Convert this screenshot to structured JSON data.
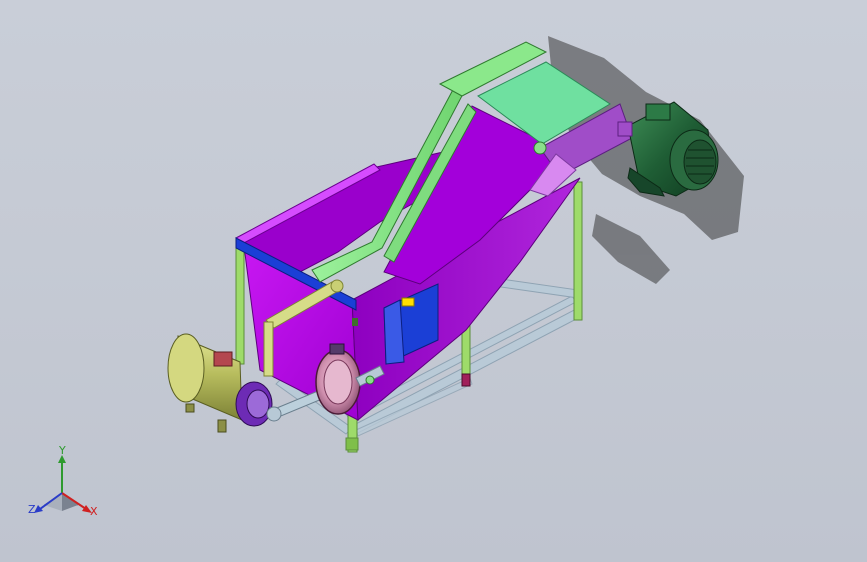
{
  "triad": {
    "x_label": "X",
    "y_label": "Y",
    "z_label": "Z"
  },
  "colors": {
    "background": "#c6cbd5",
    "tank_purple": "#b400e6",
    "conveyor_green": "#8fe88f",
    "motor_green": "#1d5a32",
    "pump_olive": "#b9bf62",
    "panel_blue": "#1b3fd6",
    "frame_steel": "#b5c7d4"
  },
  "icons": [
    "axis-triad-icon"
  ]
}
